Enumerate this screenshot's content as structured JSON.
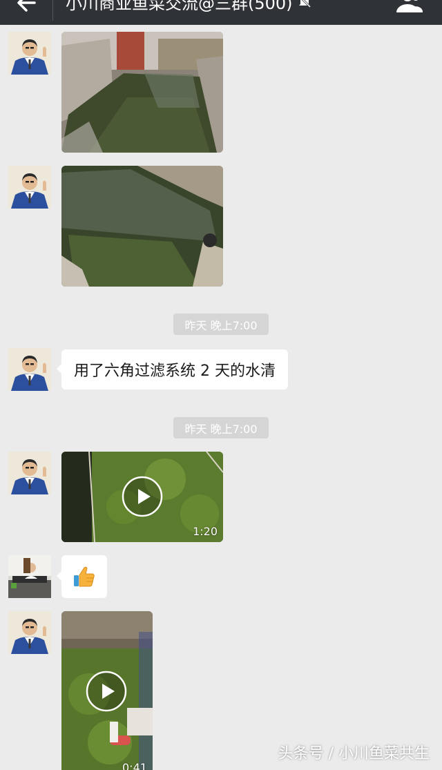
{
  "header": {
    "title": "小川商业鱼菜交流@三群(500)",
    "icons": {
      "back": "back-arrow-icon",
      "mute": "mute-bell-icon",
      "members": "group-members-icon"
    },
    "colors": {
      "background": "#2f3236",
      "text": "#ffffff"
    }
  },
  "chat": {
    "background": "#ebebeb",
    "messages": [
      {
        "type": "image",
        "sender": "member-1",
        "content": "fish-pond-photo"
      },
      {
        "type": "image",
        "sender": "member-1",
        "content": "fish-pond-photo"
      },
      {
        "type": "timestamp",
        "text": "昨天 晚上7:00"
      },
      {
        "type": "text",
        "sender": "member-1",
        "text": "用了六角过滤系统 2 天的水清"
      },
      {
        "type": "timestamp",
        "text": "昨天 晚上7:00"
      },
      {
        "type": "video",
        "sender": "member-1",
        "duration": "1:20"
      },
      {
        "type": "emoji",
        "sender": "member-2",
        "emoji": "thumbs-up-icon"
      },
      {
        "type": "video",
        "sender": "member-1",
        "duration": "0:41"
      }
    ]
  },
  "watermark": "头条号 / 小川鱼菜共生"
}
